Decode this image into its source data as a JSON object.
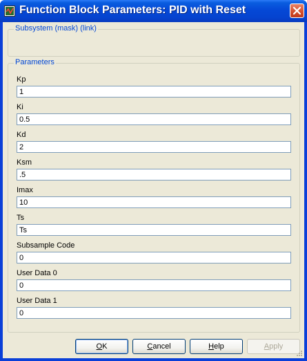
{
  "window": {
    "title": "Function Block Parameters: PID with Reset"
  },
  "subsystem": {
    "title": "Subsystem (mask) (link)"
  },
  "parameters": {
    "title": "Parameters",
    "fields": [
      {
        "label": "Kp",
        "value": "1"
      },
      {
        "label": "Ki",
        "value": "0.5"
      },
      {
        "label": "Kd",
        "value": "2"
      },
      {
        "label": "Ksm",
        "value": ".5"
      },
      {
        "label": "Imax",
        "value": "10"
      },
      {
        "label": "Ts",
        "value": "Ts"
      },
      {
        "label": "Subsample Code",
        "value": "0"
      },
      {
        "label": "User Data 0",
        "value": "0"
      },
      {
        "label": "User Data 1",
        "value": "0"
      }
    ]
  },
  "buttons": {
    "ok": {
      "first": "O",
      "rest": "K"
    },
    "cancel": {
      "first": "C",
      "rest": "ancel"
    },
    "help": {
      "first": "H",
      "rest": "elp"
    },
    "apply": {
      "first": "A",
      "rest": "pply"
    }
  },
  "icons": {
    "app": "simulink-block-icon",
    "close": "close-icon"
  },
  "colors": {
    "title_bar": "#0548d6",
    "group_title": "#0046d5",
    "close": "#d4502f"
  }
}
